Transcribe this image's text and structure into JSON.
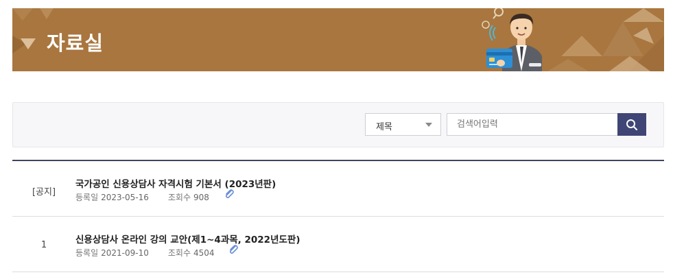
{
  "banner": {
    "title": "자료실"
  },
  "search": {
    "field_selected": "제목",
    "placeholder": "검색어입력",
    "value": ""
  },
  "colors": {
    "accent": "#3f4675",
    "banner": "#a8763e"
  },
  "list": {
    "meta_labels": {
      "date": "등록일",
      "views": "조회수"
    },
    "rows": [
      {
        "num": "[공지]",
        "title": "국가공인 신용상담사 자격시험 기본서 (2023년판)",
        "date": "2023-05-16",
        "views": "908",
        "attachment_icon": "paperclip-icon"
      },
      {
        "num": "1",
        "title": "신용상담사 온라인 강의 교안(제1~4과목, 2022년도판)",
        "date": "2021-09-10",
        "views": "4504",
        "attachment_icon": "paperclip-icon"
      }
    ]
  }
}
